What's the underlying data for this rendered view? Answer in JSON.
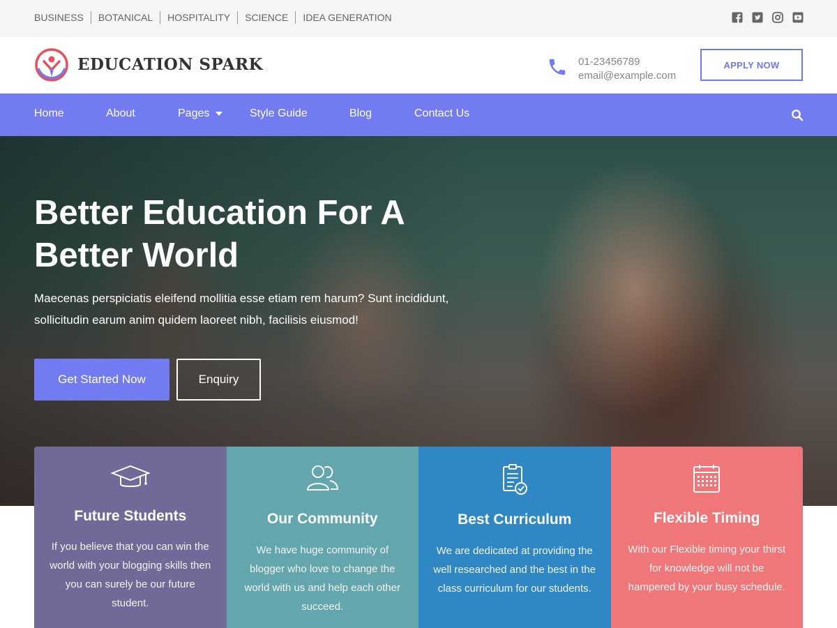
{
  "topbar": {
    "links": [
      "BUSINESS",
      "BOTANICAL",
      "HOSPITALITY",
      "SCIENCE",
      "IDEA GENERATION"
    ],
    "social_icons": [
      "facebook-icon",
      "twitter-icon",
      "instagram-icon",
      "youtube-icon"
    ]
  },
  "header": {
    "site_title": "EDUCATION SPARK",
    "phone": "01-23456789",
    "email": "email@example.com",
    "apply_label": "APPLY NOW"
  },
  "nav": {
    "items": [
      "Home",
      "About",
      "Pages",
      "Style Guide",
      "Blog",
      "Contact Us"
    ]
  },
  "hero": {
    "title": "Better Education For A Better World",
    "text": "Maecenas perspiciatis eleifend mollitia esse etiam rem harum? Sunt incididunt, sollicitudin earum anim quidem laoreet nibh, facilisis eiusmod!",
    "primary_button": "Get Started Now",
    "secondary_button": "Enquiry"
  },
  "features": [
    {
      "icon": "graduation-cap-icon",
      "title": "Future Students",
      "text": "If you believe that you can win the world with your blogging skills then you can surely be our future student."
    },
    {
      "icon": "community-icon",
      "title": "Our Community",
      "text": "We have huge community of blogger who love to change the world with us and help each other succeed."
    },
    {
      "icon": "curriculum-icon",
      "title": "Best Curriculum",
      "text": "We are dedicated at providing the well researched and the best in the class curriculum for our students."
    },
    {
      "icon": "calendar-icon",
      "title": "Flexible Timing",
      "text": "With our Flexible timing your thirst for knowledge will not be hampered by your busy schedule."
    }
  ],
  "colors": {
    "accent": "#727bf0",
    "card_1": "#6f6a98",
    "card_2": "#64a6ad",
    "card_3": "#2f88c3",
    "card_4": "#f07779"
  }
}
